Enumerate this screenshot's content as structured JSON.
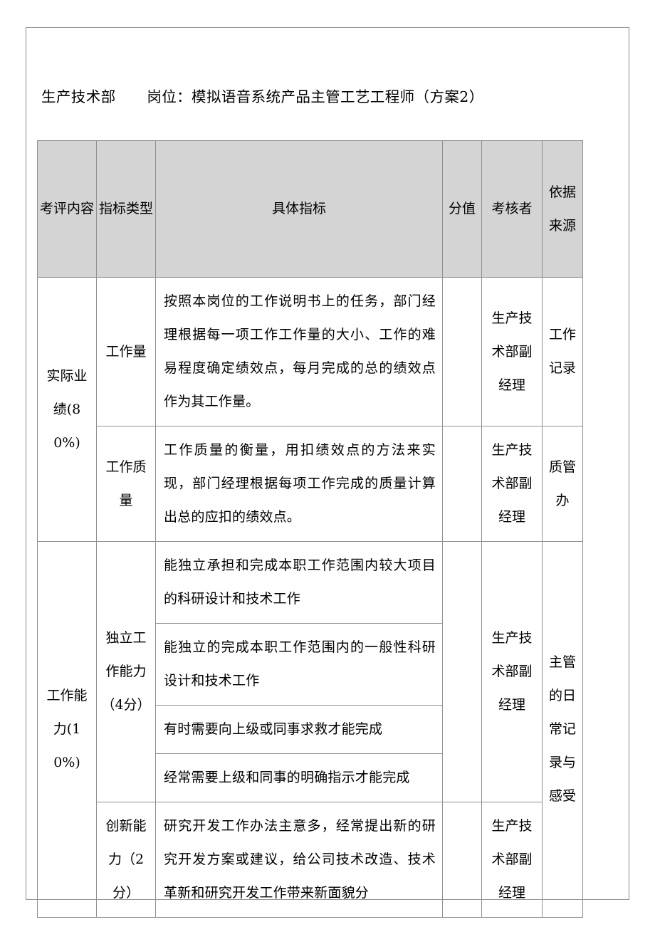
{
  "document": {
    "heading": {
      "department": "生产技术部",
      "position_label": "岗位：",
      "position_value": "模拟语音系统产品主管工艺工程师（方案2）",
      "full": "生产技术部　　岗位：模拟语音系统产品主管工艺工程师（方案2）"
    }
  },
  "table": {
    "headers": {
      "content": "考评内容",
      "type": "指标类型",
      "detail": "具体指标",
      "score": "分值",
      "rater": "考核者",
      "source": "依据来源"
    },
    "sections": [
      {
        "content": "实际业绩(80%)",
        "rows": [
          {
            "type": "工作量",
            "details": [
              "按照本岗位的工作说明书上的任务，部门经理根据每一项工作工作量的大小、工作的难易程度确定绩效点，每月完成的总的绩效点作为其工作量。"
            ],
            "score": "",
            "rater": "生产技术部副经理",
            "source": "工作记录"
          },
          {
            "type": "工作质量",
            "details": [
              "工作质量的衡量，用扣绩效点的方法来实现，部门经理根据每项工作完成的质量计算出总的应扣的绩效点。"
            ],
            "score": "",
            "rater": "生产技术部副经理",
            "source": "质管办"
          }
        ]
      },
      {
        "content": "工作能力(10%)",
        "rows": [
          {
            "type": "独立工作能力（4分）",
            "details": [
              "能独立承担和完成本职工作范围内较大项目的科研设计和技术工作",
              "能独立的完成本职工作范围内的一般性科研设计和技术工作",
              "有时需要向上级或同事求救才能完成",
              "经常需要上级和同事的明确指示才能完成"
            ],
            "score": "",
            "rater": "生产技术部副经理",
            "source": "主管的日常记录与感受"
          },
          {
            "type": "创新能力（2分）",
            "details": [
              "研究开发工作办法主意多，经常提出新的研究开发方案或建议，给公司技术改造、技术革新和研究开发工作带来新面貌分"
            ],
            "score": "",
            "rater": "生产技术部副经理",
            "source": ""
          }
        ]
      }
    ]
  },
  "style": {
    "header_background": "#d4d4d4",
    "border_color": "#8f8f8f",
    "page_border_color": "#8a8a8a",
    "text_color": "#000000"
  }
}
